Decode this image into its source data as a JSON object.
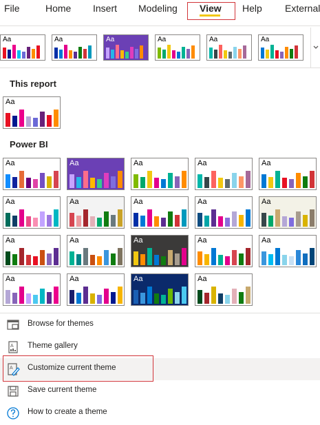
{
  "ribbon": {
    "tabs": [
      {
        "label": "File",
        "active": false
      },
      {
        "label": "Home",
        "active": false
      },
      {
        "label": "Insert",
        "active": false
      },
      {
        "label": "Modeling",
        "active": false
      },
      {
        "label": "View",
        "active": true
      },
      {
        "label": "Help",
        "active": false
      },
      {
        "label": "External",
        "active": false
      }
    ],
    "accent_color": "#f2c811",
    "highlight_color": "#d13438"
  },
  "thumb_text": "Aa",
  "strip_themes": [
    {
      "bg": "#ffffff",
      "text": "#000000",
      "bars": [
        "#e81123",
        "#00188f",
        "#ec008c",
        "#00bcf2",
        "#6b69d6",
        "#68217a",
        "#ff8c00",
        "#e81123"
      ]
    },
    {
      "bg": "#ffffff",
      "text": "#000000",
      "bars": [
        "#002fa7",
        "#0078d7",
        "#e3008c",
        "#ff8c00",
        "#5c2d91",
        "#107c10",
        "#d13438",
        "#0099bc"
      ]
    },
    {
      "bg": "#6b40b5",
      "text": "#ffffff",
      "bars": [
        "#c6a3ff",
        "#26b6e8",
        "#fd6d8b",
        "#ffb900",
        "#33cd8e",
        "#e03dbd",
        "#7f6ddf",
        "#ff8c00"
      ]
    },
    {
      "bg": "#ffffff",
      "text": "#000000",
      "bars": [
        "#7fba00",
        "#00a86b",
        "#f2c811",
        "#e3008c",
        "#0078d4",
        "#00b294",
        "#8764b8",
        "#ff8c00"
      ]
    },
    {
      "bg": "#ffffff",
      "text": "#000000",
      "bars": [
        "#01b8aa",
        "#374649",
        "#fd625e",
        "#f2c80f",
        "#5f6b6d",
        "#8ad4eb",
        "#fe9666",
        "#a66999"
      ]
    },
    {
      "bg": "#ffffff",
      "text": "#000000",
      "bars": [
        "#0078d4",
        "#f2c811",
        "#00b294",
        "#e81123",
        "#8764b8",
        "#ff8c00",
        "#107c10",
        "#d13438"
      ]
    }
  ],
  "this_report": {
    "title": "This report",
    "themes": [
      {
        "bg": "#ffffff",
        "text": "#000000",
        "bars": [
          "#e81123",
          "#00188f",
          "#ec008c",
          "#b4a7d6",
          "#6b69d6",
          "#68217a",
          "#e81123",
          "#ff8c00"
        ]
      }
    ]
  },
  "power_bi": {
    "title": "Power BI",
    "themes": [
      {
        "bg": "#ffffff",
        "text": "#000000",
        "bars": [
          "#118dff",
          "#12239e",
          "#e66c37",
          "#6b007b",
          "#e044a7",
          "#744ec2",
          "#d9b300",
          "#d64550"
        ]
      },
      {
        "bg": "#6b40b5",
        "text": "#ffffff",
        "bars": [
          "#c6a3ff",
          "#26b6e8",
          "#fd6d8b",
          "#ffb900",
          "#33cd8e",
          "#e03dbd",
          "#7f6ddf",
          "#ff8c00"
        ]
      },
      {
        "bg": "#ffffff",
        "text": "#000000",
        "bars": [
          "#7fba00",
          "#00a86b",
          "#f2c811",
          "#e3008c",
          "#0078d4",
          "#00b294",
          "#8764b8",
          "#ff8c00"
        ]
      },
      {
        "bg": "#ffffff",
        "text": "#000000",
        "bars": [
          "#01b8aa",
          "#374649",
          "#fd625e",
          "#f2c80f",
          "#5f6b6d",
          "#8ad4eb",
          "#fe9666",
          "#a66999"
        ]
      },
      {
        "bg": "#ffffff",
        "text": "#000000",
        "bars": [
          "#0078d4",
          "#f2c811",
          "#00b294",
          "#e81123",
          "#8764b8",
          "#ff8c00",
          "#107c10",
          "#d13438"
        ]
      },
      {
        "bg": "#ffffff",
        "text": "#000000",
        "bars": [
          "#006d5b",
          "#0f3e66",
          "#e3008c",
          "#ea4c89",
          "#f98fb3",
          "#c2a3ff",
          "#9c77e0",
          "#00b7c3"
        ]
      },
      {
        "bg": "#f3f3f3",
        "text": "#000000",
        "bars": [
          "#d64550",
          "#ec9a9e",
          "#a4262c",
          "#e3b0b8",
          "#00a86b",
          "#107c10",
          "#69797e",
          "#c9a227"
        ]
      },
      {
        "bg": "#ffffff",
        "text": "#000000",
        "bars": [
          "#002fa7",
          "#0078d7",
          "#e3008c",
          "#ff8c00",
          "#5c2d91",
          "#107c10",
          "#d13438",
          "#0099bc"
        ]
      },
      {
        "bg": "#ffffff",
        "text": "#000000",
        "bars": [
          "#0f4c81",
          "#00a5a8",
          "#5c2d91",
          "#e3008c",
          "#8a6fdb",
          "#b4a7d6",
          "#f7b500",
          "#0078d4"
        ]
      },
      {
        "bg": "#f3f2e7",
        "text": "#000000",
        "bars": [
          "#374649",
          "#00a86b",
          "#c8a96e",
          "#b4a7d6",
          "#7f6ddf",
          "#a79c8e",
          "#d9b300",
          "#8b7d6b"
        ]
      },
      {
        "bg": "#ffffff",
        "text": "#000000",
        "bars": [
          "#004b1c",
          "#107c10",
          "#a4262c",
          "#d13438",
          "#e81123",
          "#ca5010",
          "#8764b8",
          "#5c2d91"
        ]
      },
      {
        "bg": "#ffffff",
        "text": "#000000",
        "bars": [
          "#00b294",
          "#038387",
          "#69797e",
          "#ca5010",
          "#ff8c00",
          "#3a96dd",
          "#107c10",
          "#7e735f"
        ]
      },
      {
        "bg": "#3b3a39",
        "text": "#ffffff",
        "bars": [
          "#f2c811",
          "#ff8c00",
          "#00b294",
          "#0078d4",
          "#107c10",
          "#c8a96e",
          "#a79c8e",
          "#e3008c"
        ]
      },
      {
        "bg": "#ffffff",
        "text": "#000000",
        "bars": [
          "#ff8c00",
          "#f7b500",
          "#0078d4",
          "#00b294",
          "#e3008c",
          "#d64550",
          "#107c10",
          "#a4262c"
        ]
      },
      {
        "bg": "#ffffff",
        "text": "#000000",
        "bars": [
          "#3a96dd",
          "#00bcf2",
          "#0078d4",
          "#8ad4eb",
          "#c7e0f4",
          "#2b88d8",
          "#106ebe",
          "#004578"
        ]
      },
      {
        "bg": "#ffffff",
        "text": "#000000",
        "bars": [
          "#b4a7d6",
          "#8764b8",
          "#e3008c",
          "#c2a3ff",
          "#4cc9f0",
          "#00b7c3",
          "#5c2d91",
          "#ec008c"
        ]
      },
      {
        "bg": "#ffffff",
        "text": "#000000",
        "bars": [
          "#1b1f6b",
          "#0078d4",
          "#5c2d91",
          "#d9b300",
          "#7f6ddf",
          "#e3008c",
          "#00188f",
          "#f7b500"
        ]
      },
      {
        "bg": "#0b2a6b",
        "text": "#ffffff",
        "bars": [
          "#1a5fb4",
          "#3a96dd",
          "#0078d4",
          "#107c10",
          "#00b294",
          "#6bb700",
          "#8ad4eb",
          "#4cc9f0"
        ]
      },
      {
        "bg": "#ffffff",
        "text": "#000000",
        "bars": [
          "#004b1c",
          "#a4262c",
          "#d9b300",
          "#0f3e66",
          "#8ad4eb",
          "#e3b0b8",
          "#107c10",
          "#c8a96e"
        ]
      }
    ]
  },
  "menu_items": [
    {
      "label": "Browse for themes",
      "icon": "browse-icon",
      "hover": false
    },
    {
      "label": "Theme gallery",
      "icon": "gallery-icon",
      "hover": false
    },
    {
      "label": "Customize current theme",
      "icon": "customize-icon",
      "hover": true
    },
    {
      "label": "Save current theme",
      "icon": "save-icon",
      "hover": false
    },
    {
      "label": "How to create a theme",
      "icon": "help-icon",
      "hover": false
    }
  ]
}
